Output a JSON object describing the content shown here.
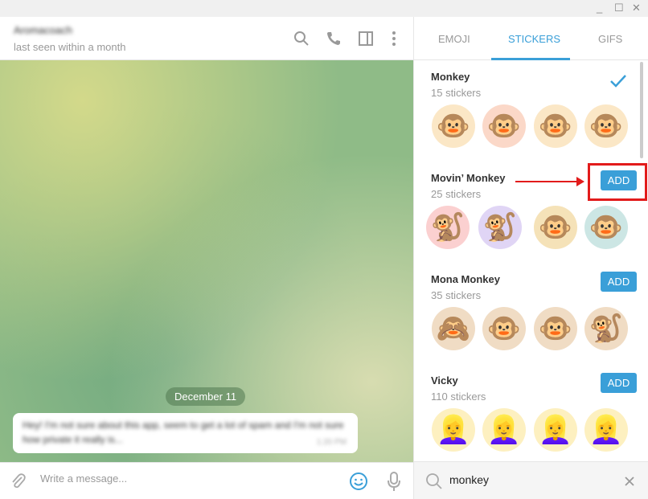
{
  "window": {
    "minimize": "_",
    "maximize": "☐",
    "close": "✕"
  },
  "chat": {
    "name": "Aromacoach",
    "status": "last seen within a month",
    "date": "December 11",
    "message": "Hey! I'm not sure about this app, seem to get a lot of spam and I'm not sure how private it really is...",
    "message_time": "1:20 PM",
    "placeholder": "Write a message..."
  },
  "tabs": [
    {
      "label": "EMOJI"
    },
    {
      "label": "STICKERS",
      "active": true
    },
    {
      "label": "GIFS"
    }
  ],
  "packs": [
    {
      "name": "Monkey",
      "count": "15 stickers",
      "installed": true,
      "stickers": [
        "🐵",
        "🐵",
        "🐵",
        "🐵"
      ]
    },
    {
      "name": "Movin’ Monkey",
      "count": "25 stickers",
      "add": "ADD",
      "stickers": [
        "🐒",
        "🐒",
        "🐵",
        "🐵"
      ]
    },
    {
      "name": "Mona Monkey",
      "count": "35 stickers",
      "add": "ADD",
      "stickers": [
        "🙈",
        "🐵",
        "🐵",
        "🐒"
      ]
    },
    {
      "name": "Vicky",
      "count": "110 stickers",
      "add": "ADD",
      "stickers": [
        "👱‍♀️",
        "👱‍♀️",
        "👱‍♀️",
        "👱‍♀️"
      ]
    }
  ],
  "search": {
    "value": "monkey"
  },
  "colors": {
    "accent": "#3a9fd8",
    "highlight": "#e21b1b"
  }
}
